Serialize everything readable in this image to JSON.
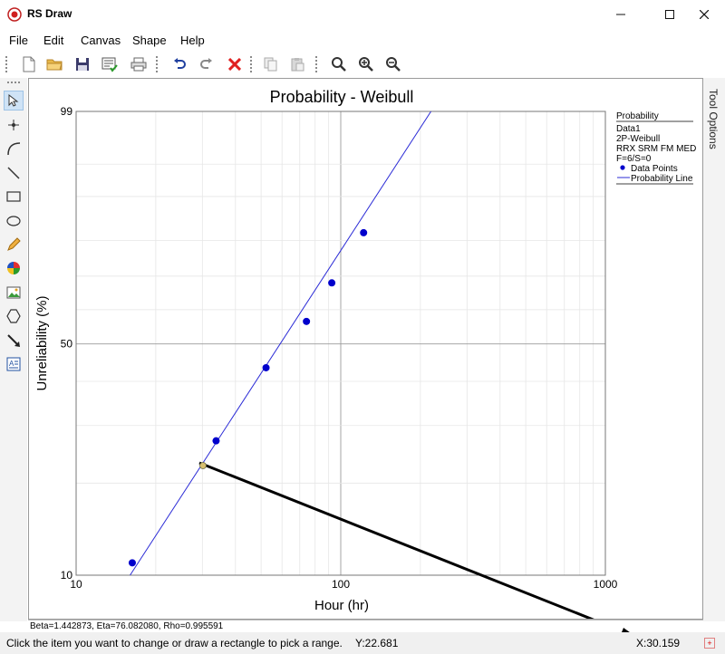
{
  "window": {
    "title": "RS Draw"
  },
  "menu": [
    "File",
    "Edit",
    "Canvas",
    "Shape",
    "Help"
  ],
  "toolbar": [
    "new-doc-icon",
    "open-folder-icon",
    "save-icon",
    "checklist-icon",
    "print-icon",
    "undo-icon",
    "redo-icon",
    "delete-icon",
    "copy-icon",
    "paste-icon",
    "zoom-icon",
    "zoom-in-icon",
    "zoom-out-icon"
  ],
  "left_tools": [
    "pointer-icon",
    "point-icon",
    "arc-icon",
    "line-icon",
    "rectangle-icon",
    "ellipse-icon",
    "pencil-icon",
    "pie-icon",
    "image-icon",
    "polygon-icon",
    "arrow-icon",
    "text-box-icon"
  ],
  "right_panel": {
    "label": "Tool Options"
  },
  "chart_data": {
    "type": "scatter",
    "title": "Probability - Weibull",
    "xlabel": "Hour (hr)",
    "ylabel": "Unreliability (%)",
    "x_scale": "log",
    "xlim": [
      10,
      1000
    ],
    "x_ticks": [
      "10",
      "100",
      "1000"
    ],
    "y_scale": "weibull",
    "ylim": [
      10,
      99
    ],
    "y_ticks": [
      "99",
      "50",
      "10"
    ],
    "grid": true,
    "points": [
      {
        "x": 16.3,
        "y": 11.0
      },
      {
        "x": 33.8,
        "y": 27.0
      },
      {
        "x": 52.2,
        "y": 43.5
      },
      {
        "x": 74.2,
        "y": 56.5
      },
      {
        "x": 92.5,
        "y": 68.0
      },
      {
        "x": 122.0,
        "y": 82.0
      }
    ],
    "fit_line": {
      "beta": 1.442873,
      "eta": 76.08208
    },
    "marker": {
      "x": 30.159,
      "y": 22.681
    },
    "legend": {
      "title": "Probability",
      "lines": [
        "Data1",
        "2P-Weibull",
        "RRX SRM FM MED",
        "F=6/S=0"
      ],
      "entries": [
        "Data Points",
        "Probability Line"
      ],
      "position": "right"
    },
    "colors": {
      "points": "#0000cc",
      "line": "#2b2bd6",
      "marker": "#d8c070"
    }
  },
  "stats_text": "Beta=1.442873, Eta=76.082080, Rho=0.995591",
  "status": {
    "message": "Click the item you want to change or draw a rectangle to pick a range.",
    "y": "Y:22.681",
    "x": "X:30.159"
  }
}
